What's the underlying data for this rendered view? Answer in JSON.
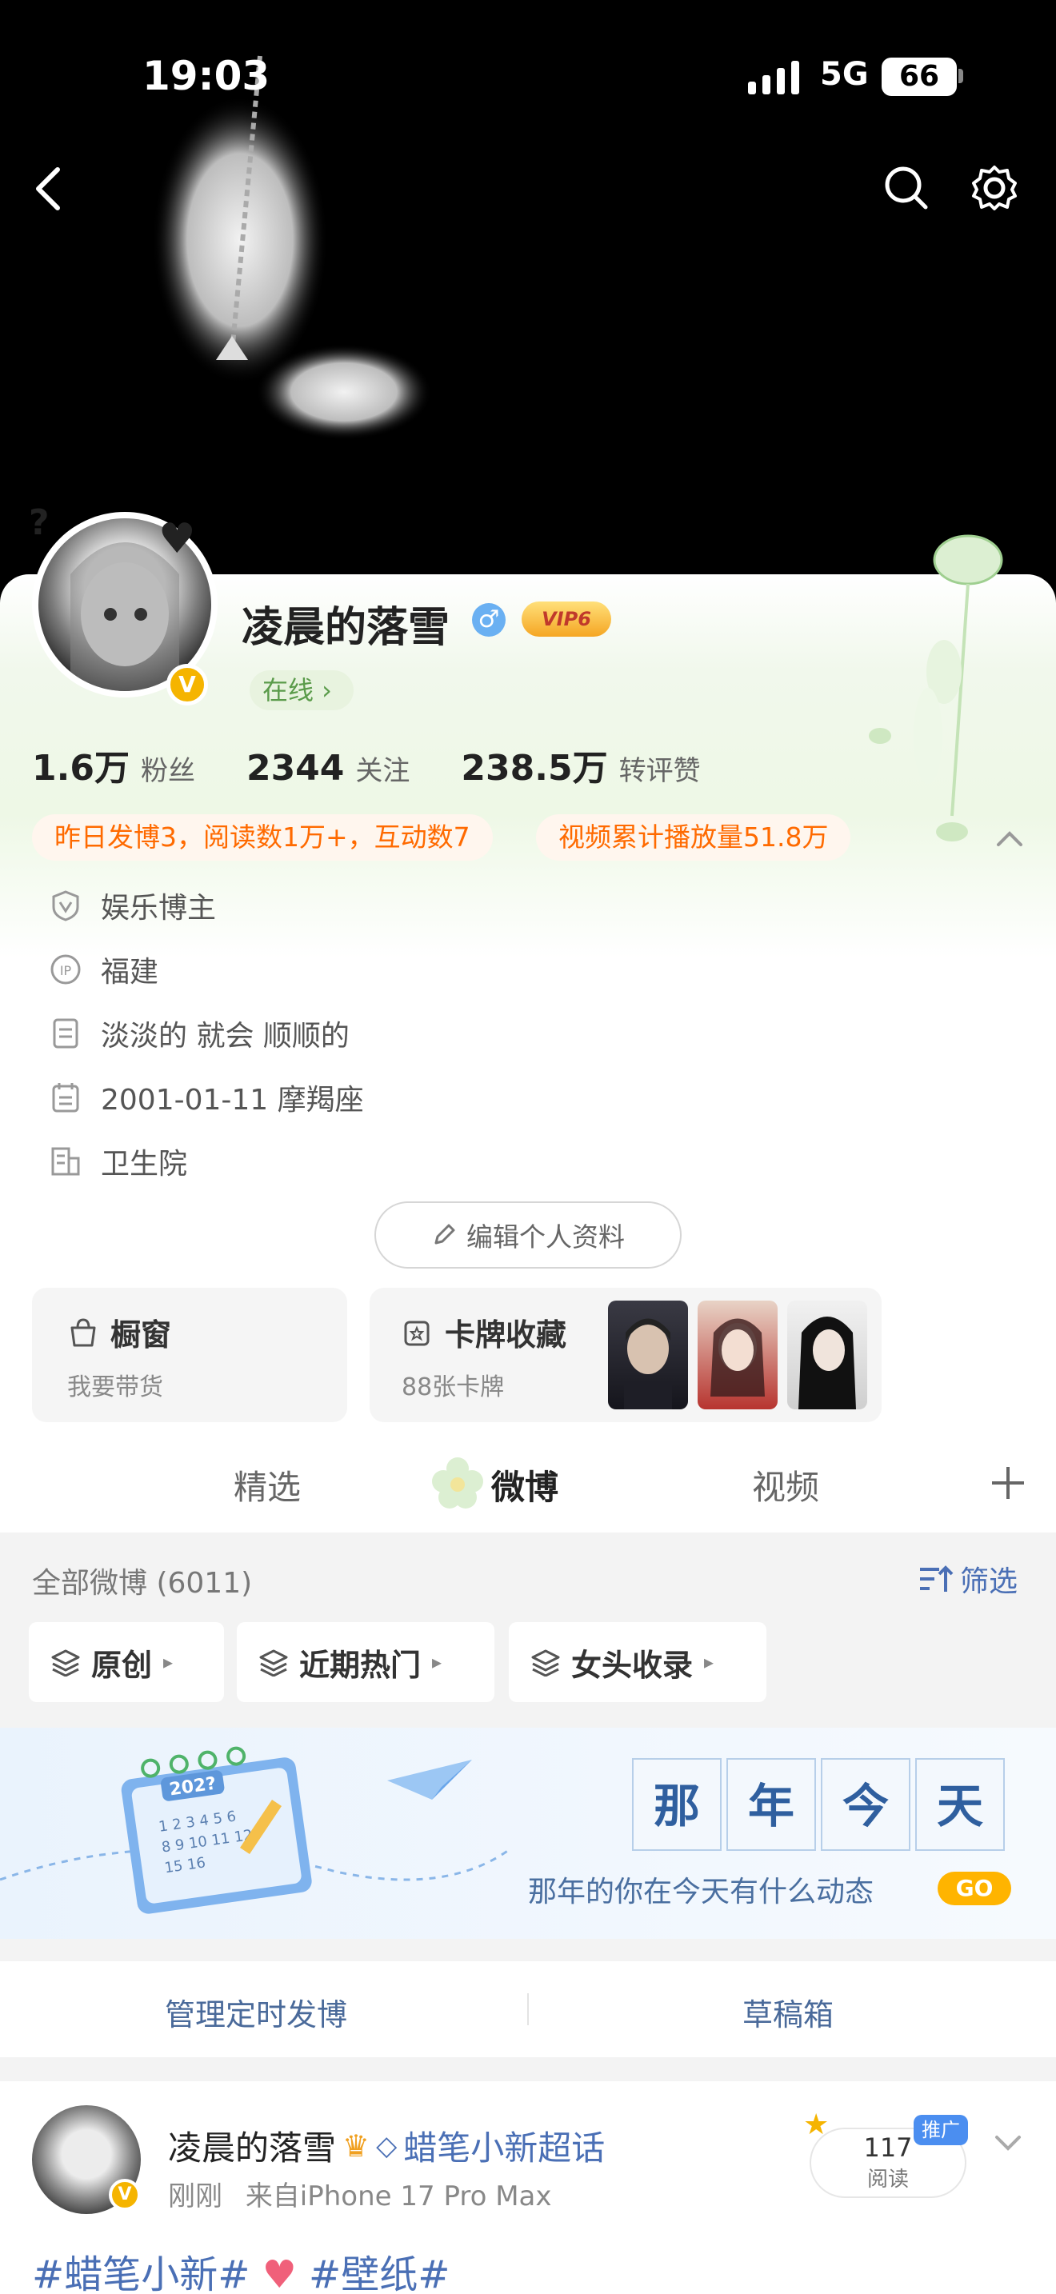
{
  "status_bar": {
    "time": "19:03",
    "network": "5G",
    "battery": "66"
  },
  "profile": {
    "name": "凌晨的落雪",
    "gender_symbol": "♂",
    "vip": "VIP6",
    "online": "在线 ›",
    "stats": [
      {
        "value": "1.6万",
        "label": "粉丝"
      },
      {
        "value": "2344",
        "label": "关注"
      },
      {
        "value": "238.5万",
        "label": "转评赞"
      }
    ],
    "pills": [
      "昨日发博3，阅读数1万+，互动数7",
      "视频累计播放量51.8万"
    ],
    "info": [
      {
        "icon": "shield-v-icon",
        "text": "娱乐博主"
      },
      {
        "icon": "ip-icon",
        "text": "福建"
      },
      {
        "icon": "document-icon",
        "text": "淡淡的 就会 顺顺的"
      },
      {
        "icon": "calendar-icon",
        "text": "2001-01-11 摩羯座"
      },
      {
        "icon": "building-icon",
        "text": "卫生院"
      }
    ],
    "edit_label": "编辑个人资料",
    "shop": {
      "title": "橱窗",
      "sub": "我要带货"
    },
    "cards": {
      "title": "卡牌收藏",
      "sub": "88张卡牌"
    }
  },
  "tabs": [
    "精选",
    "微博",
    "视频"
  ],
  "feed": {
    "count": "全部微博 (6011)",
    "filter": "筛选",
    "chips": [
      "原创",
      "近期热门",
      "女头收录"
    ],
    "banner": {
      "chars": [
        "那",
        "年",
        "今",
        "天"
      ],
      "sub": "那年的你在今天有什么动态",
      "go": "GO",
      "calendar_year": "202?",
      "calendar_days": [
        "1 2 3 4 5 6",
        "8 9 10 11 12",
        "15 16"
      ]
    },
    "manage": [
      "管理定时发博",
      "草稿箱"
    ],
    "post": {
      "name": "凌晨的落雪",
      "topic": "蜡笔小新超话",
      "time": "刚刚",
      "source": "来自iPhone 17 Pro Max",
      "reads": "117",
      "reads_label": "阅读",
      "promo": "推广",
      "tags_a": "#蜡笔小新#",
      "tags_b": "#壁纸#"
    }
  },
  "colors": {
    "accent_orange": "#ff6a00",
    "link_blue": "#4a6fb5",
    "online_green": "#5a9b4a"
  }
}
